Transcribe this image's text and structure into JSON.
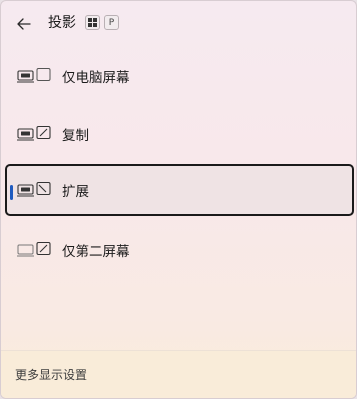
{
  "header": {
    "title": "投影",
    "shortcut_key": "P"
  },
  "options": [
    {
      "label": "仅电脑屏幕",
      "icon": "pc-screen-only-icon",
      "selected": false
    },
    {
      "label": "复制",
      "icon": "duplicate-icon",
      "selected": false
    },
    {
      "label": "扩展",
      "icon": "extend-icon",
      "selected": true
    },
    {
      "label": "仅第二屏幕",
      "icon": "second-screen-only-icon",
      "selected": false
    }
  ],
  "footer": {
    "link_label": "更多显示设置"
  },
  "colors": {
    "accent": "#1f5bbf",
    "selected_border": "#1a1a1a"
  }
}
